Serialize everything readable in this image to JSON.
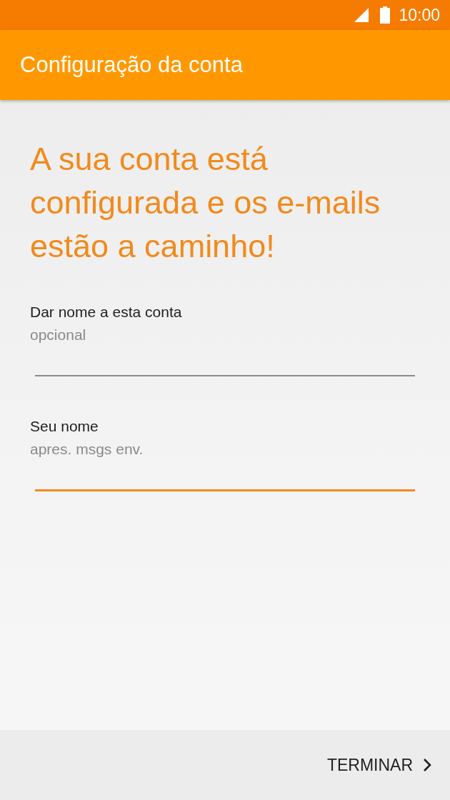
{
  "status_bar": {
    "time": "10:00"
  },
  "app_bar": {
    "title": "Configuração da conta"
  },
  "headline": "A sua conta está configurada e os e-mails estão a caminho!",
  "fields": [
    {
      "label": "Dar nome a esta conta",
      "hint": "opcional",
      "focused": false
    },
    {
      "label": "Seu nome",
      "hint": "apres. msgs env.",
      "focused": true
    }
  ],
  "footer": {
    "button": "TERMINAR"
  }
}
